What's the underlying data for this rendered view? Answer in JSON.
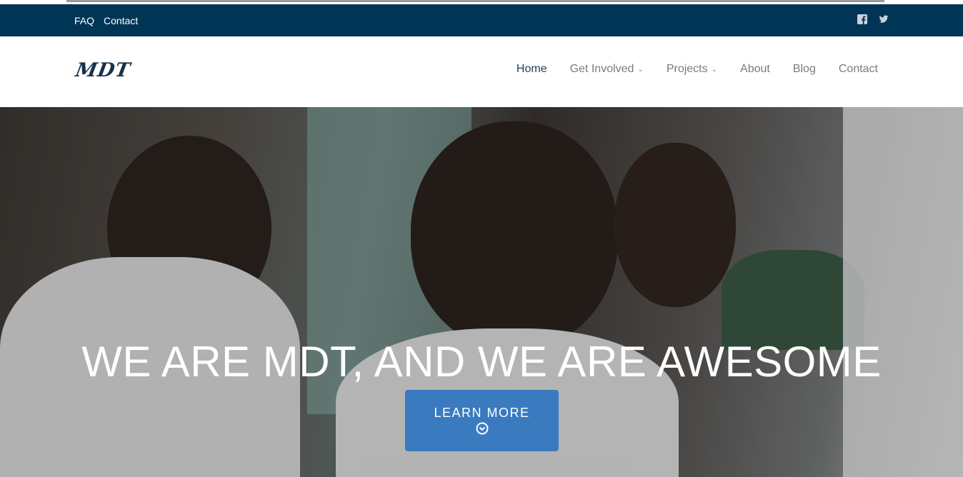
{
  "topbar": {
    "links": [
      "FAQ",
      "Contact"
    ],
    "social_icons": [
      "facebook-icon",
      "twitter-icon"
    ],
    "background": "#003556"
  },
  "navbar": {
    "logo": "MDT",
    "menu": [
      {
        "label": "Home",
        "active": true,
        "dropdown": false
      },
      {
        "label": "Get Involved",
        "active": false,
        "dropdown": true
      },
      {
        "label": "Projects",
        "active": false,
        "dropdown": true
      },
      {
        "label": "About",
        "active": false,
        "dropdown": false
      },
      {
        "label": "Blog",
        "active": false,
        "dropdown": false
      },
      {
        "label": "Contact",
        "active": false,
        "dropdown": false
      }
    ]
  },
  "hero": {
    "headline": "WE ARE MDT, AND WE ARE AWESOME",
    "cta_label": "LEARN MORE",
    "cta_icon": "chevron-circle-down-icon",
    "cta_color": "#3a7bc0"
  }
}
